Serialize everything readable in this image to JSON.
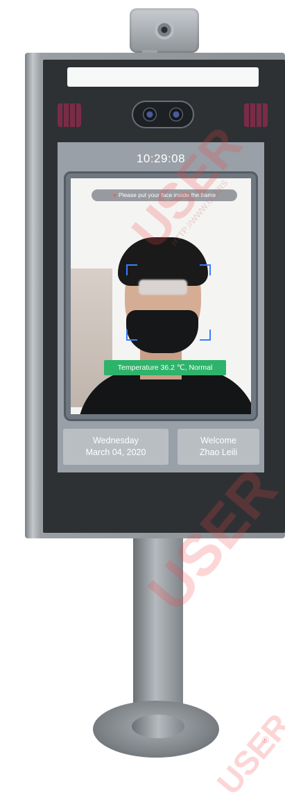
{
  "screen": {
    "time": "10:29:08",
    "hint": "Please put your face inside the frame",
    "temperature_status": "Temperature 36.2 ℃, Normal",
    "date_card": {
      "weekday": "Wednesday",
      "date": "March 04, 2020"
    },
    "welcome_card": {
      "greeting": "Welcome",
      "name": "Zhao Leili"
    }
  },
  "watermark": {
    "brand": "USER",
    "registered": "®",
    "url": "HTTP://WWW.USERS"
  },
  "icons": [
    "temperature-sensor-icon",
    "dual-camera-icon",
    "ir-illuminator-icon"
  ],
  "colors": {
    "status_ok": "#2eb36a",
    "detect_frame": "#3a7cff",
    "bezel": "#2e3134"
  }
}
